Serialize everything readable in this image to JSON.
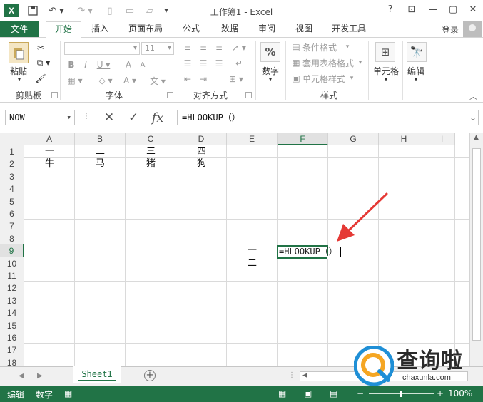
{
  "window": {
    "title": "工作簿1 - Excel",
    "help": "?",
    "controls": [
      "⊡",
      "—",
      "▢",
      "✕"
    ]
  },
  "tabs": {
    "file": "文件",
    "items": [
      "开始",
      "插入",
      "页面布局",
      "公式",
      "数据",
      "审阅",
      "视图",
      "开发工具"
    ],
    "active": "开始",
    "login": "登录"
  },
  "ribbon": {
    "clipboard": {
      "paste": "粘贴",
      "label": "剪贴板"
    },
    "font": {
      "name": "",
      "size": "11",
      "label": "字体"
    },
    "alignment": {
      "label": "对齐方式"
    },
    "number": {
      "button": "数字",
      "symbol": "%"
    },
    "styles": {
      "conditional": "条件格式",
      "table": "套用表格格式",
      "cell": "单元格样式",
      "label": "样式"
    },
    "cells": {
      "button": "单元格"
    },
    "editing": {
      "button": "编辑"
    }
  },
  "formula_bar": {
    "name_box": "NOW",
    "cancel_symbol": "✕",
    "enter_symbol": "✓",
    "fx_symbol": "fx",
    "content": "=HLOOKUP（）"
  },
  "grid": {
    "columns": [
      "A",
      "B",
      "C",
      "D",
      "E",
      "F",
      "G",
      "H",
      "I"
    ],
    "rows": [
      "1",
      "2",
      "3",
      "4",
      "5",
      "6",
      "7",
      "8",
      "9",
      "10",
      "11",
      "12",
      "13",
      "14",
      "15",
      "16",
      "17",
      "18"
    ],
    "selected_column": "F",
    "selected_row": "9",
    "cells": {
      "A1": "一",
      "B1": "二",
      "C1": "三",
      "D1": "四",
      "A2": "牛",
      "B2": "马",
      "C2": "猪",
      "D2": "狗",
      "E9": "一",
      "E10": "二"
    },
    "editing_cell": "F9",
    "editing_text": "=HLOOKUP（）"
  },
  "sheets": {
    "tabs": [
      "Sheet1"
    ],
    "active": "Sheet1",
    "add": "+"
  },
  "status": {
    "mode": "编辑",
    "numlock": "数字",
    "zoom": "100%"
  },
  "watermark": {
    "text": "查询啦",
    "url": "chaxunla.com"
  },
  "colors": {
    "accent": "#217346",
    "annotation_arrow": "#e53935"
  }
}
